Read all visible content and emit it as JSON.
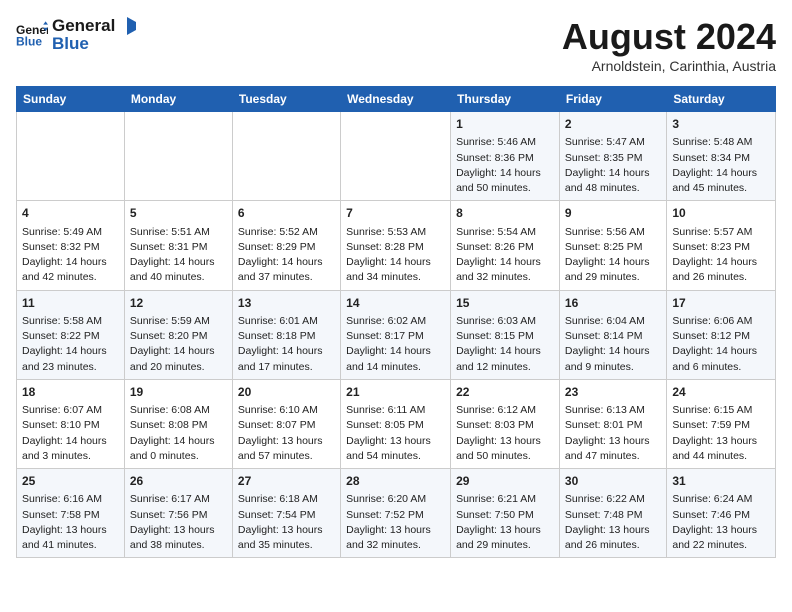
{
  "header": {
    "logo_line1": "General",
    "logo_line2": "Blue",
    "month": "August 2024",
    "location": "Arnoldstein, Carinthia, Austria"
  },
  "days_of_week": [
    "Sunday",
    "Monday",
    "Tuesday",
    "Wednesday",
    "Thursday",
    "Friday",
    "Saturday"
  ],
  "weeks": [
    [
      {
        "day": "",
        "content": ""
      },
      {
        "day": "",
        "content": ""
      },
      {
        "day": "",
        "content": ""
      },
      {
        "day": "",
        "content": ""
      },
      {
        "day": "1",
        "content": "Sunrise: 5:46 AM\nSunset: 8:36 PM\nDaylight: 14 hours and 50 minutes."
      },
      {
        "day": "2",
        "content": "Sunrise: 5:47 AM\nSunset: 8:35 PM\nDaylight: 14 hours and 48 minutes."
      },
      {
        "day": "3",
        "content": "Sunrise: 5:48 AM\nSunset: 8:34 PM\nDaylight: 14 hours and 45 minutes."
      }
    ],
    [
      {
        "day": "4",
        "content": "Sunrise: 5:49 AM\nSunset: 8:32 PM\nDaylight: 14 hours and 42 minutes."
      },
      {
        "day": "5",
        "content": "Sunrise: 5:51 AM\nSunset: 8:31 PM\nDaylight: 14 hours and 40 minutes."
      },
      {
        "day": "6",
        "content": "Sunrise: 5:52 AM\nSunset: 8:29 PM\nDaylight: 14 hours and 37 minutes."
      },
      {
        "day": "7",
        "content": "Sunrise: 5:53 AM\nSunset: 8:28 PM\nDaylight: 14 hours and 34 minutes."
      },
      {
        "day": "8",
        "content": "Sunrise: 5:54 AM\nSunset: 8:26 PM\nDaylight: 14 hours and 32 minutes."
      },
      {
        "day": "9",
        "content": "Sunrise: 5:56 AM\nSunset: 8:25 PM\nDaylight: 14 hours and 29 minutes."
      },
      {
        "day": "10",
        "content": "Sunrise: 5:57 AM\nSunset: 8:23 PM\nDaylight: 14 hours and 26 minutes."
      }
    ],
    [
      {
        "day": "11",
        "content": "Sunrise: 5:58 AM\nSunset: 8:22 PM\nDaylight: 14 hours and 23 minutes."
      },
      {
        "day": "12",
        "content": "Sunrise: 5:59 AM\nSunset: 8:20 PM\nDaylight: 14 hours and 20 minutes."
      },
      {
        "day": "13",
        "content": "Sunrise: 6:01 AM\nSunset: 8:18 PM\nDaylight: 14 hours and 17 minutes."
      },
      {
        "day": "14",
        "content": "Sunrise: 6:02 AM\nSunset: 8:17 PM\nDaylight: 14 hours and 14 minutes."
      },
      {
        "day": "15",
        "content": "Sunrise: 6:03 AM\nSunset: 8:15 PM\nDaylight: 14 hours and 12 minutes."
      },
      {
        "day": "16",
        "content": "Sunrise: 6:04 AM\nSunset: 8:14 PM\nDaylight: 14 hours and 9 minutes."
      },
      {
        "day": "17",
        "content": "Sunrise: 6:06 AM\nSunset: 8:12 PM\nDaylight: 14 hours and 6 minutes."
      }
    ],
    [
      {
        "day": "18",
        "content": "Sunrise: 6:07 AM\nSunset: 8:10 PM\nDaylight: 14 hours and 3 minutes."
      },
      {
        "day": "19",
        "content": "Sunrise: 6:08 AM\nSunset: 8:08 PM\nDaylight: 14 hours and 0 minutes."
      },
      {
        "day": "20",
        "content": "Sunrise: 6:10 AM\nSunset: 8:07 PM\nDaylight: 13 hours and 57 minutes."
      },
      {
        "day": "21",
        "content": "Sunrise: 6:11 AM\nSunset: 8:05 PM\nDaylight: 13 hours and 54 minutes."
      },
      {
        "day": "22",
        "content": "Sunrise: 6:12 AM\nSunset: 8:03 PM\nDaylight: 13 hours and 50 minutes."
      },
      {
        "day": "23",
        "content": "Sunrise: 6:13 AM\nSunset: 8:01 PM\nDaylight: 13 hours and 47 minutes."
      },
      {
        "day": "24",
        "content": "Sunrise: 6:15 AM\nSunset: 7:59 PM\nDaylight: 13 hours and 44 minutes."
      }
    ],
    [
      {
        "day": "25",
        "content": "Sunrise: 6:16 AM\nSunset: 7:58 PM\nDaylight: 13 hours and 41 minutes."
      },
      {
        "day": "26",
        "content": "Sunrise: 6:17 AM\nSunset: 7:56 PM\nDaylight: 13 hours and 38 minutes."
      },
      {
        "day": "27",
        "content": "Sunrise: 6:18 AM\nSunset: 7:54 PM\nDaylight: 13 hours and 35 minutes."
      },
      {
        "day": "28",
        "content": "Sunrise: 6:20 AM\nSunset: 7:52 PM\nDaylight: 13 hours and 32 minutes."
      },
      {
        "day": "29",
        "content": "Sunrise: 6:21 AM\nSunset: 7:50 PM\nDaylight: 13 hours and 29 minutes."
      },
      {
        "day": "30",
        "content": "Sunrise: 6:22 AM\nSunset: 7:48 PM\nDaylight: 13 hours and 26 minutes."
      },
      {
        "day": "31",
        "content": "Sunrise: 6:24 AM\nSunset: 7:46 PM\nDaylight: 13 hours and 22 minutes."
      }
    ]
  ]
}
